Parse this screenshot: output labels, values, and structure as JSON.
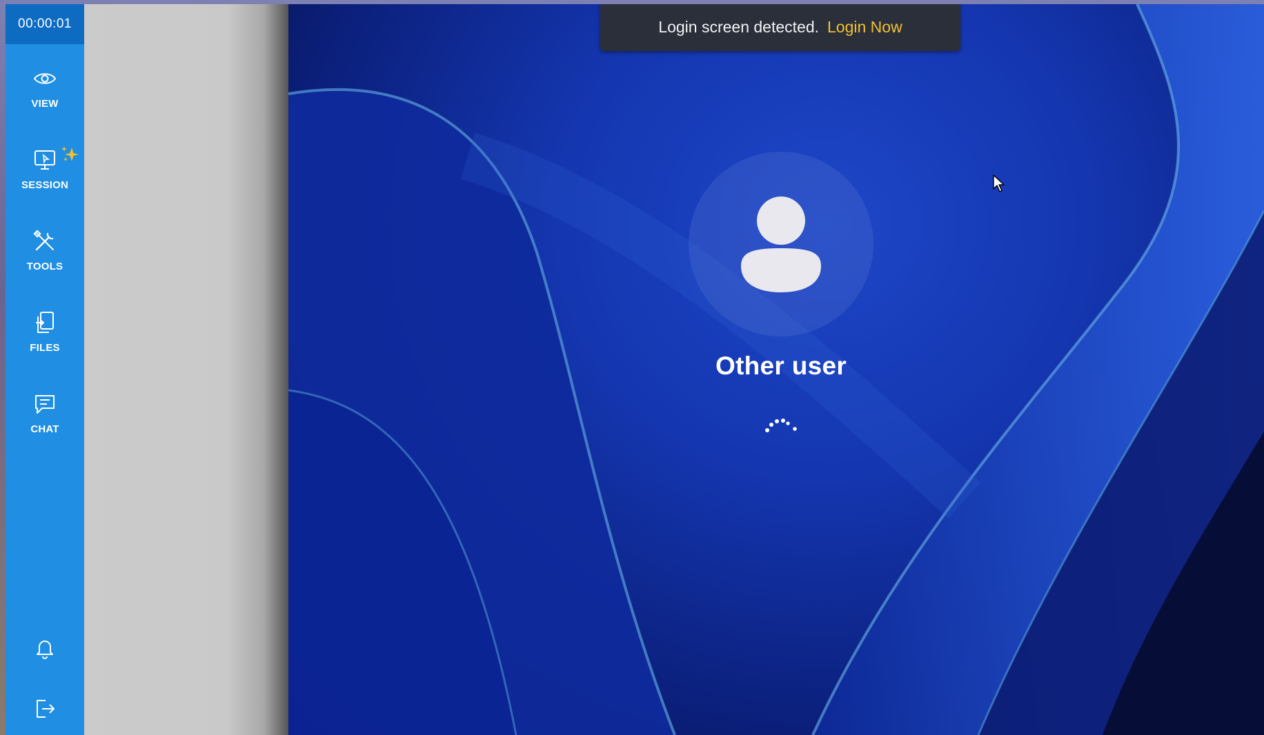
{
  "sidebar": {
    "timer": "00:00:01",
    "items": [
      {
        "label": "VIEW",
        "icon": "eye-icon"
      },
      {
        "label": "SESSION",
        "icon": "monitor-icon"
      },
      {
        "label": "TOOLS",
        "icon": "tools-icon"
      },
      {
        "label": "FILES",
        "icon": "files-icon"
      },
      {
        "label": "CHAT",
        "icon": "chat-icon"
      }
    ],
    "bottom_icons": [
      "bell-icon",
      "logout-icon"
    ],
    "accent_color": "#1f8ee3",
    "timer_bg_color": "#0d6bc2"
  },
  "toast": {
    "message": "Login screen detected.",
    "action": "Login Now",
    "action_color": "#f2c230"
  },
  "remote_screen": {
    "user_name": "Other user",
    "avatar_icon": "user-avatar-icon",
    "status_icon": "loading-spinner-icon"
  }
}
